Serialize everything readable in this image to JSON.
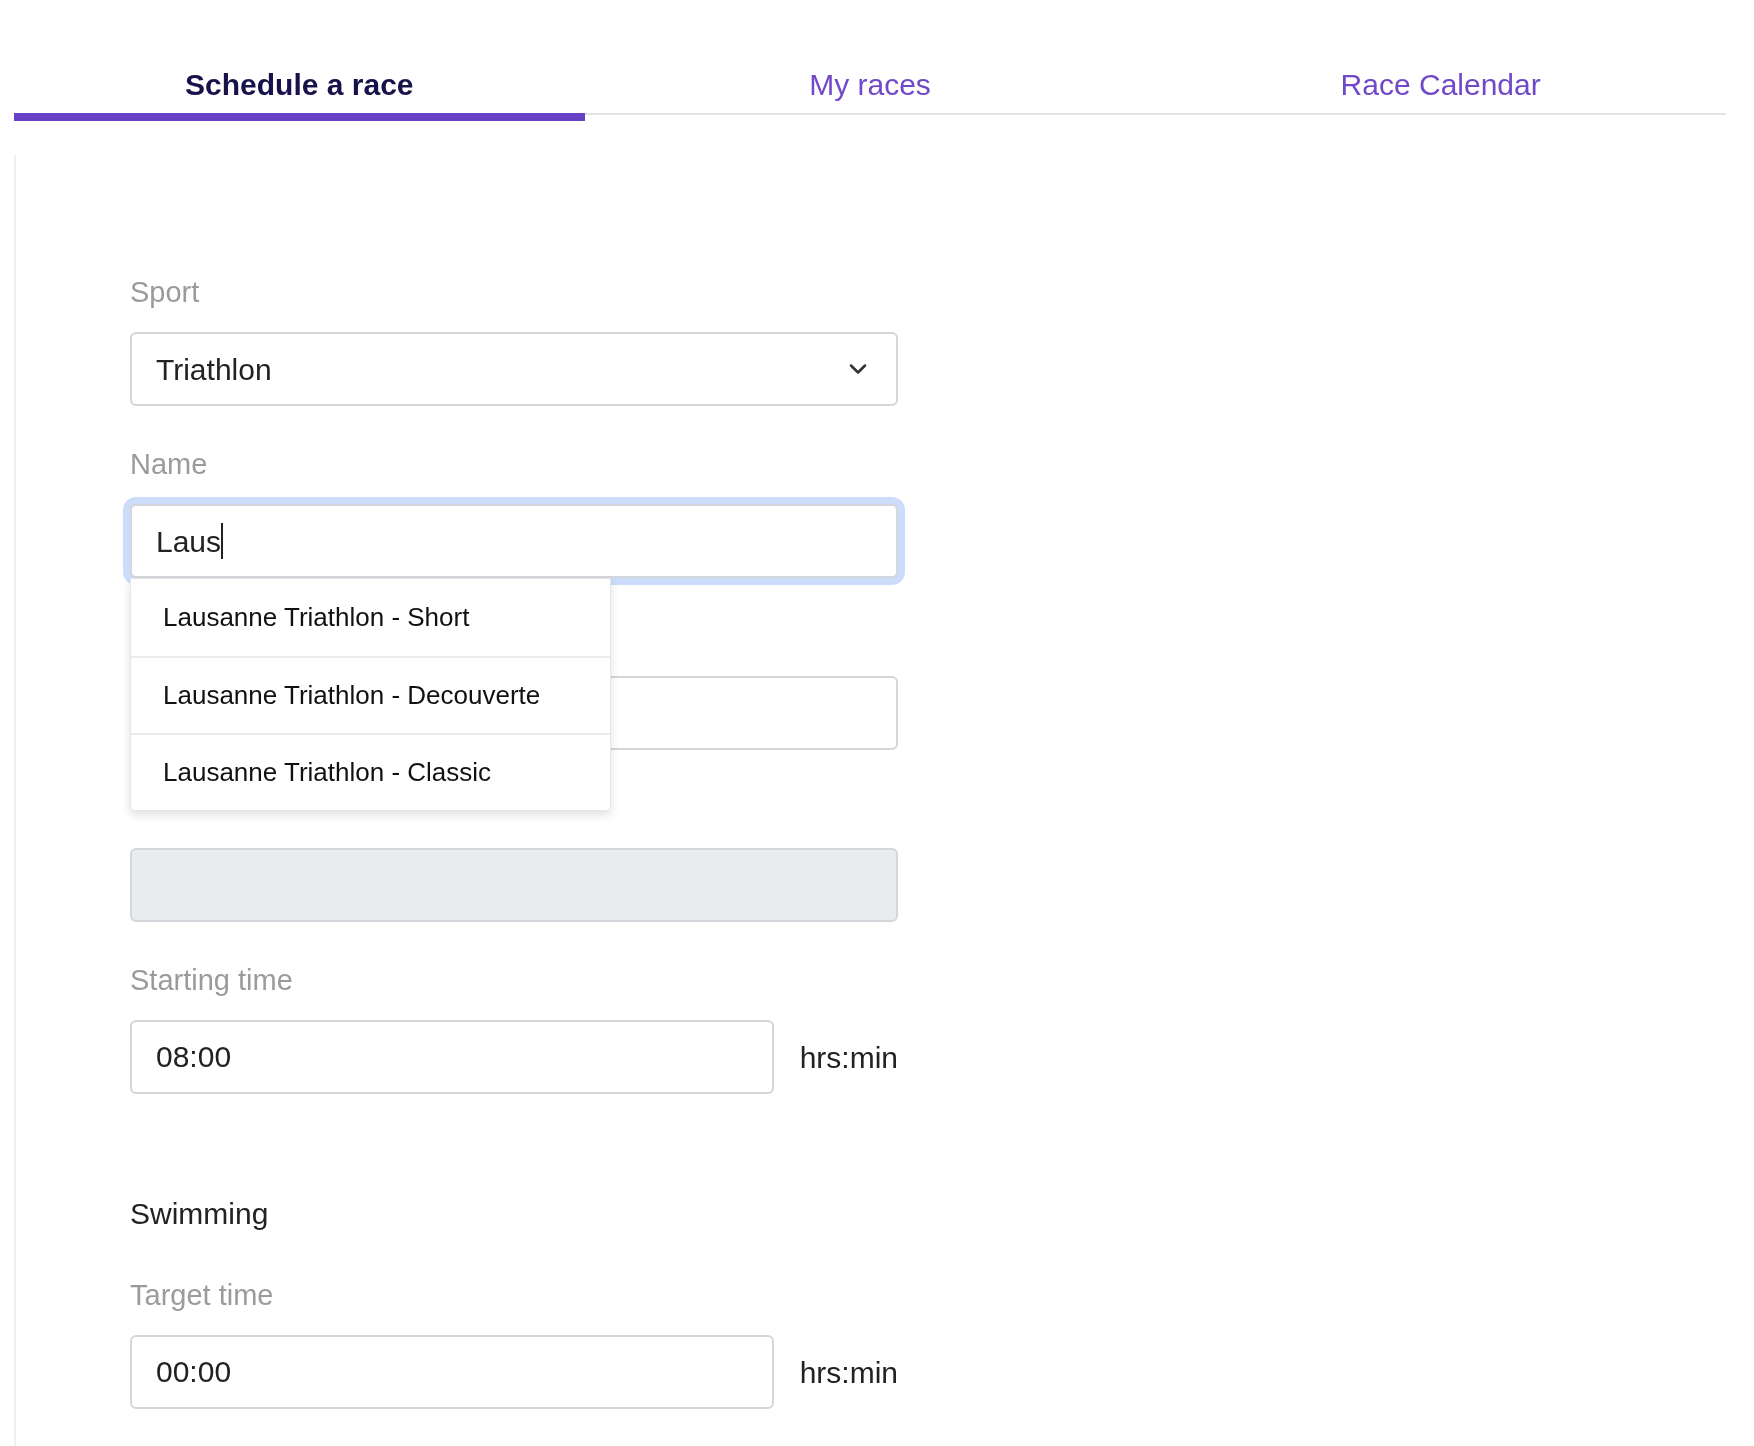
{
  "tabs": [
    {
      "label": "Schedule a race",
      "selected": true
    },
    {
      "label": "My races",
      "selected": false
    },
    {
      "label": "Race Calendar",
      "selected": false
    }
  ],
  "form": {
    "sport": {
      "label": "Sport",
      "value": "Triathlon"
    },
    "name": {
      "label": "Name",
      "value": "Laus",
      "focused": true
    },
    "suggestions": [
      "Lausanne Triathlon - Short",
      "Lausanne Triathlon - Decouverte",
      "Lausanne Triathlon - Classic"
    ],
    "date": {
      "disabled": true
    },
    "starting_time": {
      "label": "Starting time",
      "value": "08:00",
      "unit": "hrs:min"
    }
  },
  "swimming": {
    "heading": "Swimming",
    "target_time": {
      "label": "Target time",
      "value": "00:00",
      "unit": "hrs:min"
    }
  }
}
